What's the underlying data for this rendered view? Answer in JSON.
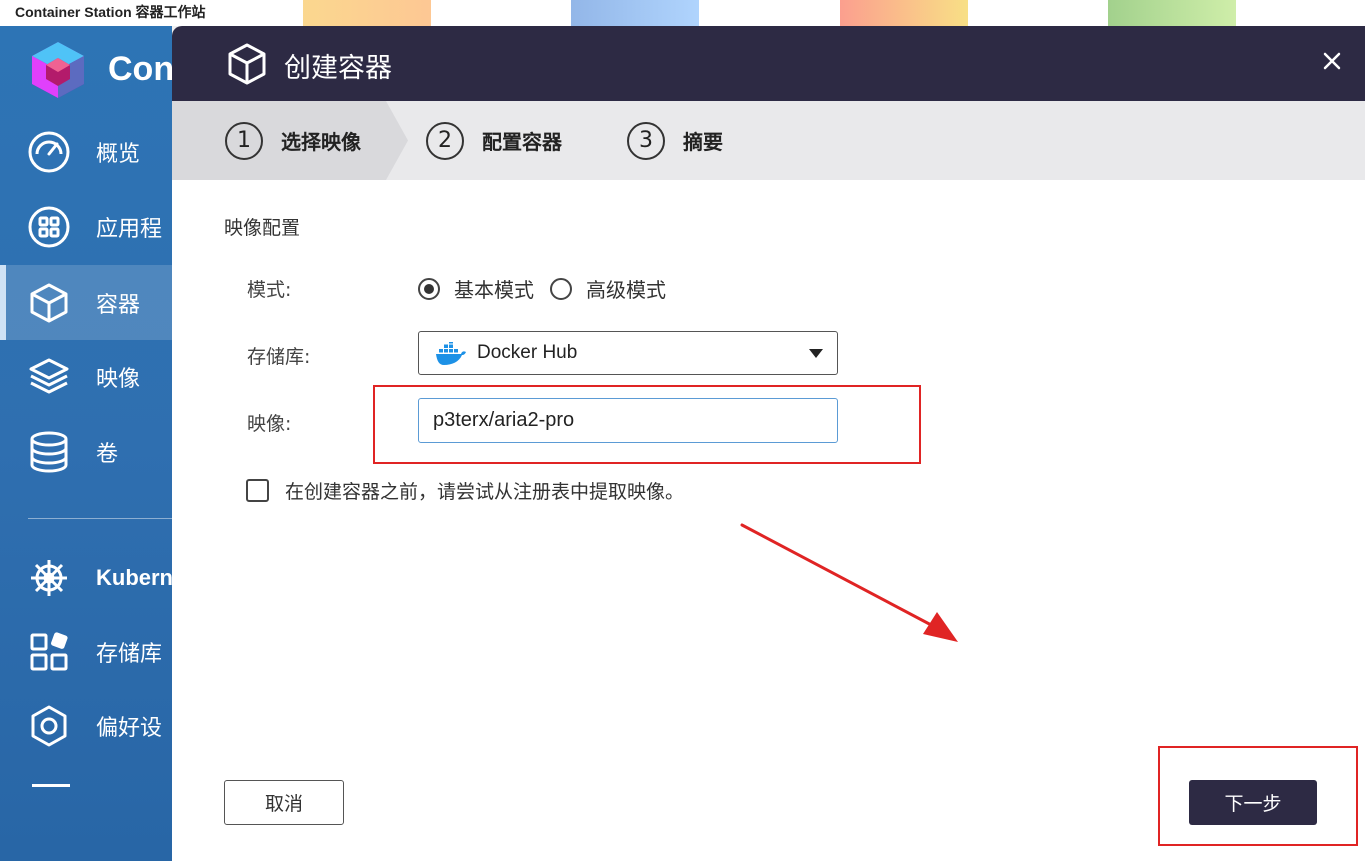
{
  "window": {
    "title": "Container Station 容器工作站"
  },
  "sidebar": {
    "brand": "Con",
    "items": [
      {
        "label": "概览",
        "icon": "gauge-icon"
      },
      {
        "label": "应用程",
        "icon": "apps-grid-icon"
      },
      {
        "label": "容器",
        "icon": "cube-icon",
        "active": true
      },
      {
        "label": "映像",
        "icon": "layers-icon"
      },
      {
        "label": "卷",
        "icon": "database-icon"
      },
      {
        "label": "Kubern",
        "icon": "helm-wheel-icon"
      },
      {
        "label": "存储库",
        "icon": "registry-icon"
      },
      {
        "label": "偏好设",
        "icon": "gear-icon"
      }
    ]
  },
  "dialog": {
    "title": "创建容器",
    "close_icon": "close-icon",
    "steps": [
      {
        "num": "1",
        "label": "选择映像",
        "active": true
      },
      {
        "num": "2",
        "label": "配置容器"
      },
      {
        "num": "3",
        "label": "摘要"
      }
    ],
    "section_title": "映像配置",
    "mode": {
      "label": "模式:",
      "options": [
        "基本模式",
        "高级模式"
      ],
      "selected": "基本模式"
    },
    "registry": {
      "label": "存储库:",
      "value": "Docker Hub",
      "icon": "docker-whale-icon"
    },
    "image": {
      "label": "映像:",
      "value": "p3terx/aria2-pro"
    },
    "pull_checkbox": {
      "label": "在创建容器之前，请尝试从注册表中提取映像。",
      "checked": false
    },
    "buttons": {
      "cancel": "取消",
      "next": "下一步"
    }
  },
  "colors": {
    "sidebar": "#2d74b5",
    "header": "#2d2a44",
    "annotation": "#e02424",
    "next_button": "#2d2a44"
  }
}
